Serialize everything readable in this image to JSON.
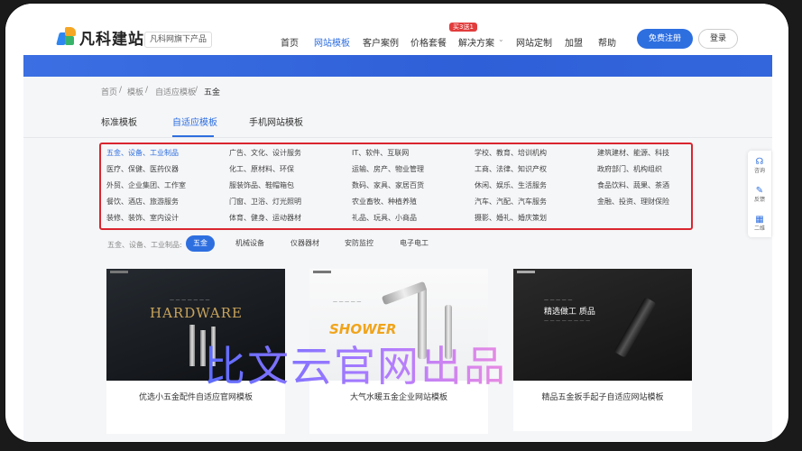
{
  "brand": {
    "name": "凡科建站",
    "sub": "凡科网旗下产品"
  },
  "nav": {
    "items": [
      "首页",
      "网站模板",
      "客户案例",
      "价格套餐",
      "解决方案",
      "网站定制",
      "加盟",
      "帮助"
    ],
    "hot_badge": "买3送1",
    "register": "免费注册",
    "login": "登录"
  },
  "breadcrumb": [
    "首页",
    "/",
    "模板",
    "/",
    "自适应模板",
    "/",
    "五金"
  ],
  "tabs": [
    "标准模板",
    "自适应模板",
    "手机网站模板"
  ],
  "filters": [
    [
      "五金、设备、工业制品",
      "广告、文化、设计服务",
      "IT、软件、互联网",
      "学校、教育、培训机构",
      "建筑建材、能源、科技"
    ],
    [
      "医疗、保健、医药仪器",
      "化工、原材料、环保",
      "运输、房产、物业管理",
      "工商、法律、知识产权",
      "政府部门、机构组织"
    ],
    [
      "外贸、企业集团、工作室",
      "服装饰品、鞋帽箱包",
      "数码、家具、家居百货",
      "休闲、娱乐、生活服务",
      "食品饮料、蔬果、茶酒"
    ],
    [
      "餐饮、酒店、旅游服务",
      "门窗、卫浴、灯光照明",
      "农业畜牧、种植养殖",
      "汽车、汽配、汽车服务",
      "金融、投资、理财保险"
    ],
    [
      "装修、装饰、室内设计",
      "体育、健身、运动器材",
      "礼品、玩具、小商品",
      "摄影、婚礼、婚庆策划",
      ""
    ]
  ],
  "subfilter": {
    "label": "五金、设备、工业制品:",
    "chips": [
      "五金",
      "机械设备",
      "仪器器材",
      "安防监控",
      "电子电工"
    ]
  },
  "side_tools": [
    "咨询",
    "反馈",
    "二维"
  ],
  "templates": [
    {
      "title": "优选小五金配件自适应官网模板",
      "img_text": "HARDWARE"
    },
    {
      "title": "大气水暖五金企业网站模板",
      "img_text": "SHOWER"
    },
    {
      "title": "精品五金扳手起子自适应网站模板",
      "img_text": "精选做工 质品"
    }
  ],
  "watermark": "比文云官网出品",
  "colors": {
    "accent": "#2e6fe0",
    "highlight_box": "#d9252f",
    "badge": "#e23c3c"
  }
}
